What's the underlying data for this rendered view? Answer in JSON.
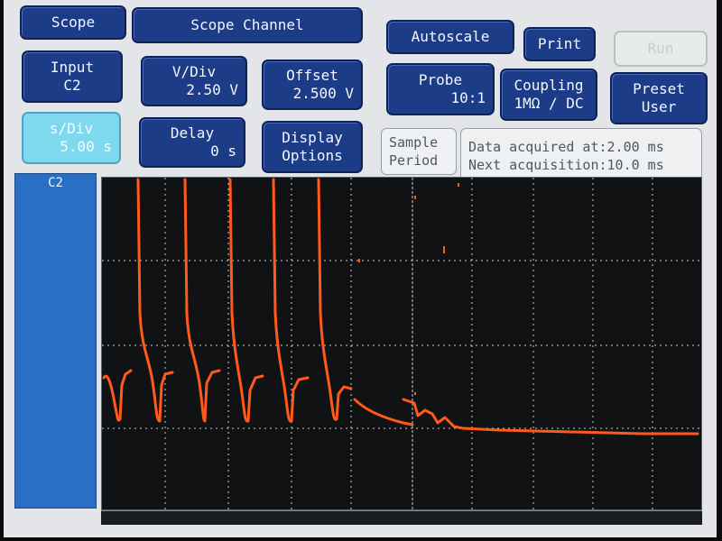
{
  "toolbar": {
    "scope": "Scope",
    "scope_channel": "Scope Channel",
    "autoscale": "Autoscale",
    "print": "Print",
    "run": "Run"
  },
  "input": {
    "label": "Input",
    "value": "C2"
  },
  "vdiv": {
    "label": "V/Div",
    "value": "2.50  V"
  },
  "offset": {
    "label": "Offset",
    "value": "2.500  V"
  },
  "probe": {
    "label": "Probe",
    "value": "10:1"
  },
  "coupling": {
    "label": "Coupling",
    "value": "1MΩ / DC"
  },
  "preset": {
    "label": "Preset",
    "value": "User"
  },
  "sdiv": {
    "label": "s/Div",
    "value": "5.00  s"
  },
  "delay": {
    "label": "Delay",
    "value": "0  s"
  },
  "display_options": {
    "line1": "Display",
    "line2": "Options"
  },
  "sample_period": {
    "line1": "Sample",
    "line2": "Period"
  },
  "acquisition": {
    "line1": "Data acquired at:2.00 ms",
    "line2": "Next acquisition:10.0 ms"
  },
  "channel": {
    "label": "C2"
  },
  "colors": {
    "trace": "#ff5a1a",
    "grid": "#c8ccd2",
    "button": "#1d3c87",
    "active": "#7fd9ee"
  }
}
